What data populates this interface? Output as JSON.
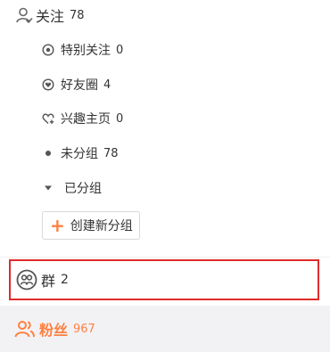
{
  "follow": {
    "label": "关注",
    "count": "78"
  },
  "subitems": {
    "special": {
      "label": "特别关注",
      "count": "0"
    },
    "friends": {
      "label": "好友圈",
      "count": "4"
    },
    "interest": {
      "label": "兴趣主页",
      "count": "0"
    },
    "ungrouped": {
      "label": "未分组",
      "count": "78"
    },
    "grouped": {
      "label": "已分组"
    }
  },
  "create_group": {
    "label": "创建新分组"
  },
  "group": {
    "label": "群",
    "count": "2"
  },
  "fans": {
    "label": "粉丝",
    "count": "967"
  },
  "colors": {
    "accent": "#ff8140",
    "highlight_border": "#e02b2b",
    "fans_bg": "#f2f2f5"
  }
}
